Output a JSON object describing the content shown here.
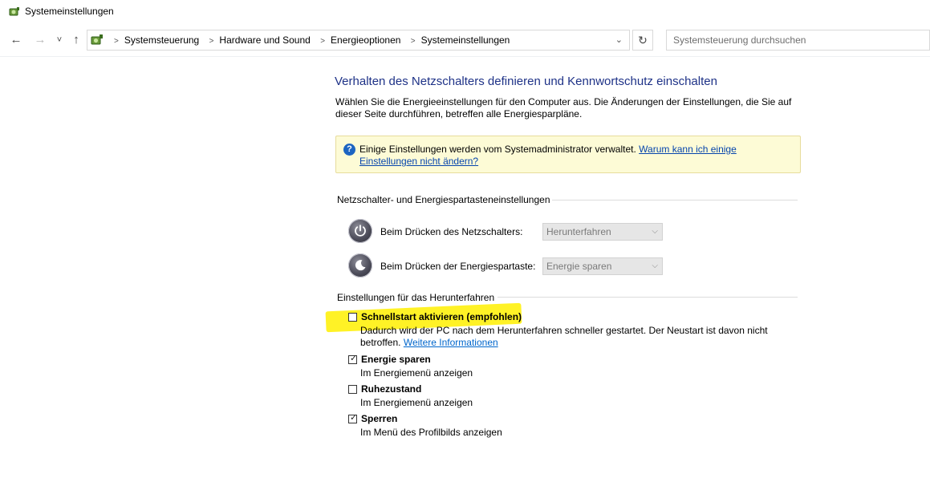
{
  "window": {
    "title": "Systemeinstellungen",
    "icon": "power-options-icon"
  },
  "nav": {
    "back": "←",
    "forward": "→",
    "recent": "˅",
    "up": "↑"
  },
  "address": {
    "crumbs": [
      "Systemsteuerung",
      "Hardware und Sound",
      "Energieoptionen",
      "Systemeinstellungen"
    ],
    "dropdown": "⌄",
    "refresh": "↻"
  },
  "search": {
    "placeholder": "Systemsteuerung durchsuchen",
    "value": ""
  },
  "main": {
    "title": "Verhalten des Netzschalters definieren und Kennwortschutz einschalten",
    "description": "Wählen Sie die Energieeinstellungen für den Computer aus. Die Änderungen der Einstellungen, die Sie auf dieser Seite durchführen, betreffen alle Energiesparpläne."
  },
  "info": {
    "icon": "question-icon",
    "icon_glyph": "?",
    "text": "Einige Einstellungen werden vom Systemadministrator verwaltet. ",
    "link": "Warum kann ich einige Einstellungen nicht ändern?"
  },
  "power_buttons": {
    "group_label": "Netzschalter- und Energiespartasteneinstellungen",
    "rows": [
      {
        "label": "Beim Drücken des Netzschalters:",
        "value": "Herunterfahren"
      },
      {
        "label": "Beim Drücken der Energiespartaste:",
        "value": "Energie sparen"
      }
    ]
  },
  "shutdown": {
    "group_label": "Einstellungen für das Herunterfahren",
    "options": [
      {
        "title": "Schnellstart aktivieren (empfohlen)",
        "checked": false,
        "desc": "Dadurch wird der PC nach dem Herunterfahren schneller gestartet. Der Neustart ist davon nicht betroffen. ",
        "link": "Weitere Informationen"
      },
      {
        "title": "Energie sparen",
        "checked": true,
        "desc": "Im Energiemenü anzeigen"
      },
      {
        "title": "Ruhezustand",
        "checked": false,
        "desc": "Im Energiemenü anzeigen"
      },
      {
        "title": "Sperren",
        "checked": true,
        "desc": "Im Menü des Profilbilds anzeigen"
      }
    ]
  },
  "colors": {
    "title_blue": "#1e3287",
    "link_blue": "#0066cc",
    "info_bg": "#fdfbd6",
    "highlight": "#fff000"
  }
}
